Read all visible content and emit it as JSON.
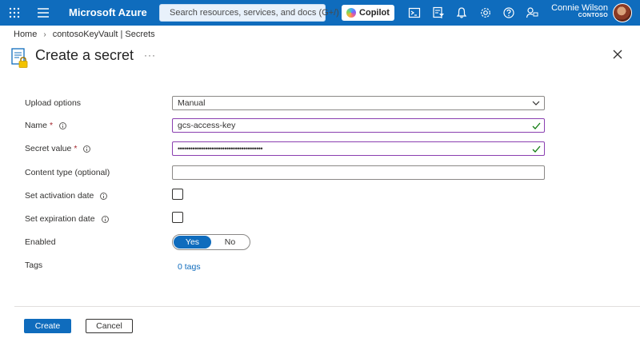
{
  "topbar": {
    "brand": "Microsoft Azure",
    "search_placeholder": "Search resources, services, and docs (G+/)",
    "copilot_label": "Copilot",
    "user_name": "Connie Wilson",
    "user_tenant": "CONTOSO",
    "icons": [
      "waffle-icon",
      "hamburger-icon",
      "search-icon",
      "cloud-shell-icon",
      "directory-filter-icon",
      "notifications-icon",
      "settings-icon",
      "help-icon",
      "feedback-icon"
    ],
    "accent": "#0f6cbd"
  },
  "breadcrumb": {
    "home": "Home",
    "current": "contosoKeyVault | Secrets"
  },
  "page": {
    "title": "Create a secret",
    "more": "···"
  },
  "form": {
    "upload_options": {
      "label": "Upload options",
      "value": "Manual"
    },
    "name": {
      "label": "Name",
      "required": "*",
      "value": "gcs-access-key"
    },
    "secret_value": {
      "label": "Secret value",
      "required": "*",
      "value": "••••••••••••••••••••••••••••••••••••••••"
    },
    "content_type": {
      "label": "Content type (optional)",
      "value": ""
    },
    "activation": {
      "label": "Set activation date"
    },
    "expiration": {
      "label": "Set expiration date"
    },
    "enabled": {
      "label": "Enabled",
      "yes": "Yes",
      "no": "No",
      "selected": "Yes"
    },
    "tags": {
      "label": "Tags",
      "link": "0 tags"
    }
  },
  "actions": {
    "create": "Create",
    "cancel": "Cancel"
  }
}
